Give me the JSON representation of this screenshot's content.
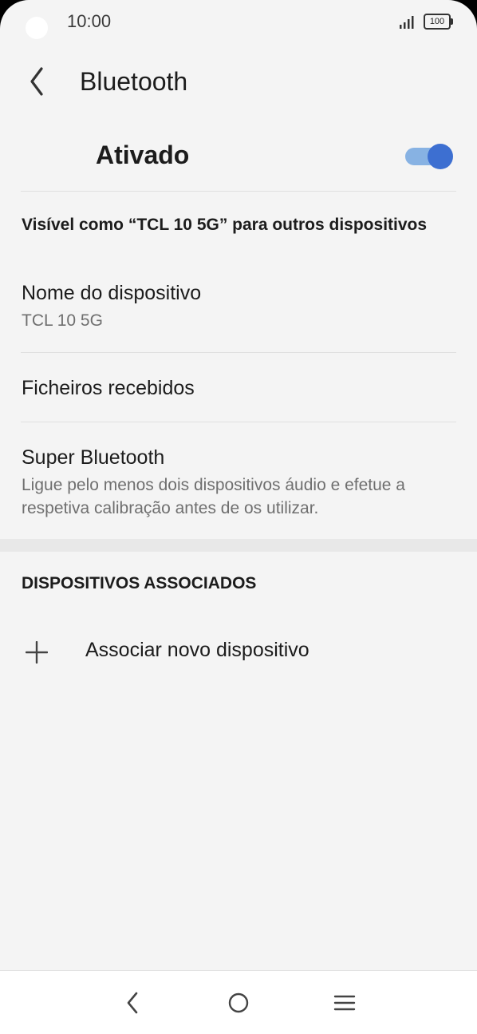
{
  "status_bar": {
    "time": "10:00",
    "battery": "100",
    "icons": [
      "camera-cutout",
      "signal-icon",
      "battery-icon"
    ]
  },
  "app_bar": {
    "title": "Bluetooth",
    "back_icon": "chevron-left-icon"
  },
  "bluetooth_toggle": {
    "label": "Ativado",
    "state": "on",
    "track_color": "#87b2e3",
    "thumb_color": "#3d6fd1"
  },
  "visibility_text": "Visível como “TCL 10 5G” para outros dispositivos",
  "settings": [
    {
      "title": "Nome do dispositivo",
      "subtitle": "TCL 10 5G"
    },
    {
      "title": "Ficheiros recebidos"
    },
    {
      "title": "Super Bluetooth",
      "subtitle": "Ligue pelo menos dois dispositivos áudio e efetue a respetiva calibração antes de os utilizar."
    }
  ],
  "paired_section": {
    "header": "DISPOSITIVOS ASSOCIADOS",
    "add_label": "Associar novo dispositivo",
    "add_icon": "plus-icon"
  },
  "nav_bar": {
    "icons": [
      "back-icon",
      "home-icon",
      "menu-icon"
    ]
  }
}
